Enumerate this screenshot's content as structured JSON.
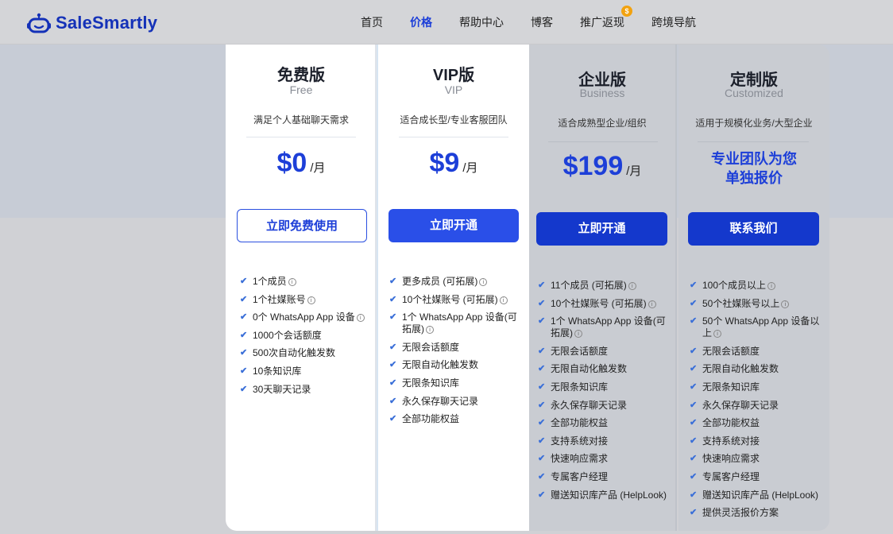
{
  "brand": {
    "name": "SaleSmartly",
    "color": "#1431b8"
  },
  "nav": {
    "items": [
      "首页",
      "价格",
      "帮助中心",
      "博客",
      "推广返现",
      "跨境导航"
    ],
    "active": "价格",
    "badge": "$"
  },
  "plans": [
    {
      "title": "免费版",
      "subtitle": "Free",
      "desc": "满足个人基础聊天需求",
      "price": "$0",
      "unit": "/月",
      "button": "立即免费使用",
      "features": [
        {
          "text": "1个成员",
          "info": true
        },
        {
          "text": "1个社媒账号",
          "info": true
        },
        {
          "text": "0个 WhatsApp App 设备",
          "info": true
        },
        {
          "text": "1000个会话额度",
          "info": false
        },
        {
          "text": "500次自动化触发数",
          "info": false
        },
        {
          "text": "10条知识库",
          "info": false
        },
        {
          "text": "30天聊天记录",
          "info": false
        }
      ]
    },
    {
      "title": "VIP版",
      "subtitle": "VIP",
      "desc": "适合成长型/专业客服团队",
      "price": "$9",
      "unit": "/月",
      "button": "立即开通",
      "features": [
        {
          "text": "更多成员 (可拓展)",
          "info": true
        },
        {
          "text": "10个社媒账号 (可拓展)",
          "info": true
        },
        {
          "text": "1个 WhatsApp App 设备(可拓展)",
          "info": true
        },
        {
          "text": "无限会话额度",
          "info": false
        },
        {
          "text": "无限自动化触发数",
          "info": false
        },
        {
          "text": "无限条知识库",
          "info": false
        },
        {
          "text": "永久保存聊天记录",
          "info": false
        },
        {
          "text": "全部功能权益",
          "info": false
        }
      ]
    },
    {
      "title": "企业版",
      "subtitle": "Business",
      "desc": "适合成熟型企业/组织",
      "price": "$199",
      "unit": "/月",
      "button": "立即开通",
      "features": [
        {
          "text": "11个成员 (可拓展)",
          "info": true
        },
        {
          "text": "10个社媒账号 (可拓展)",
          "info": true
        },
        {
          "text": "1个 WhatsApp App 设备(可拓展)",
          "info": true
        },
        {
          "text": "无限会话额度",
          "info": false
        },
        {
          "text": "无限自动化触发数",
          "info": false
        },
        {
          "text": "无限条知识库",
          "info": false
        },
        {
          "text": "永久保存聊天记录",
          "info": false
        },
        {
          "text": "全部功能权益",
          "info": false
        },
        {
          "text": "支持系统对接",
          "info": false
        },
        {
          "text": "快速响应需求",
          "info": false
        },
        {
          "text": "专属客户经理",
          "info": false
        },
        {
          "text": "赠送知识库产品 (HelpLook)",
          "info": false
        }
      ]
    },
    {
      "title": "定制版",
      "subtitle": "Customized",
      "desc": "适用于规模化业务/大型企业",
      "price_text": "专业团队为您单独报价",
      "button": "联系我们",
      "features": [
        {
          "text": "100个成员以上",
          "info": true
        },
        {
          "text": "50个社媒账号以上",
          "info": true
        },
        {
          "text": "50个 WhatsApp App 设备以上",
          "info": true
        },
        {
          "text": "无限会话额度",
          "info": false
        },
        {
          "text": "无限自动化触发数",
          "info": false
        },
        {
          "text": "无限条知识库",
          "info": false
        },
        {
          "text": "永久保存聊天记录",
          "info": false
        },
        {
          "text": "全部功能权益",
          "info": false
        },
        {
          "text": "支持系统对接",
          "info": false
        },
        {
          "text": "快速响应需求",
          "info": false
        },
        {
          "text": "专属客户经理",
          "info": false
        },
        {
          "text": "赠送知识库产品 (HelpLook)",
          "info": false
        },
        {
          "text": "提供灵活报价方案",
          "info": false
        }
      ]
    }
  ]
}
